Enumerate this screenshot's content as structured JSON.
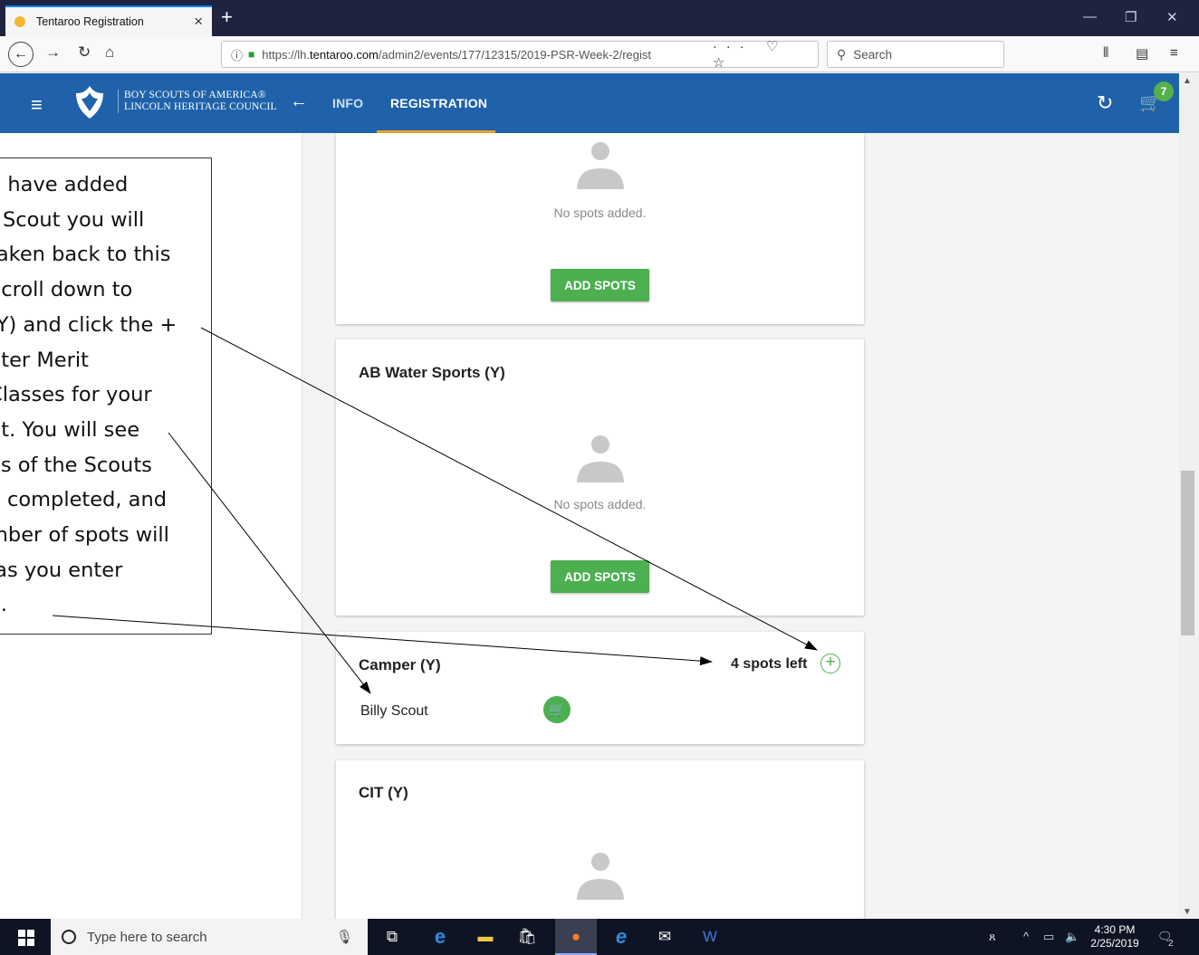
{
  "browser": {
    "tab_title": "Tentaroo Registration",
    "url_host_prefix": "https://lh.",
    "url_domain": "tentaroo.com",
    "url_path": "/admin2/events/177/12315/2019-PSR-Week-2/regist",
    "search_placeholder": "Search",
    "badge_count": "7"
  },
  "header": {
    "brand_line1": "BOY SCOUTS OF AMERICA®",
    "brand_line2": "LINCOLN HERITAGE COUNCIL",
    "nav_info": "INFO",
    "nav_registration": "REGISTRATION"
  },
  "cards": {
    "card1": {
      "empty_text": "No spots added.",
      "button": "ADD SPOTS"
    },
    "card2": {
      "title": "AB Water Sports (Y)",
      "empty_text": "No spots added.",
      "button": "ADD SPOTS"
    },
    "card3": {
      "title": "Camper (Y)",
      "spots_left": "4 spots left",
      "scout_name": "Billy Scout"
    },
    "card4": {
      "title": "CIT (Y)"
    }
  },
  "callout": {
    "text": "u have added\nt Scout you will\ntaken back to this\nScroll down to\n(Y) and click the +\nnter Merit\nClasses for your\nut. You will see\nes of the Scouts\ne completed, and\nmber of spots will\n as you enter\ne."
  },
  "taskbar": {
    "search_placeholder": "Type here to search",
    "time": "4:30 PM",
    "date": "2/25/2019",
    "notif_count": "2"
  },
  "colors": {
    "header_blue": "#1f62aa",
    "accent_green": "#4caf50",
    "tab_underline": "#f0a22e"
  }
}
